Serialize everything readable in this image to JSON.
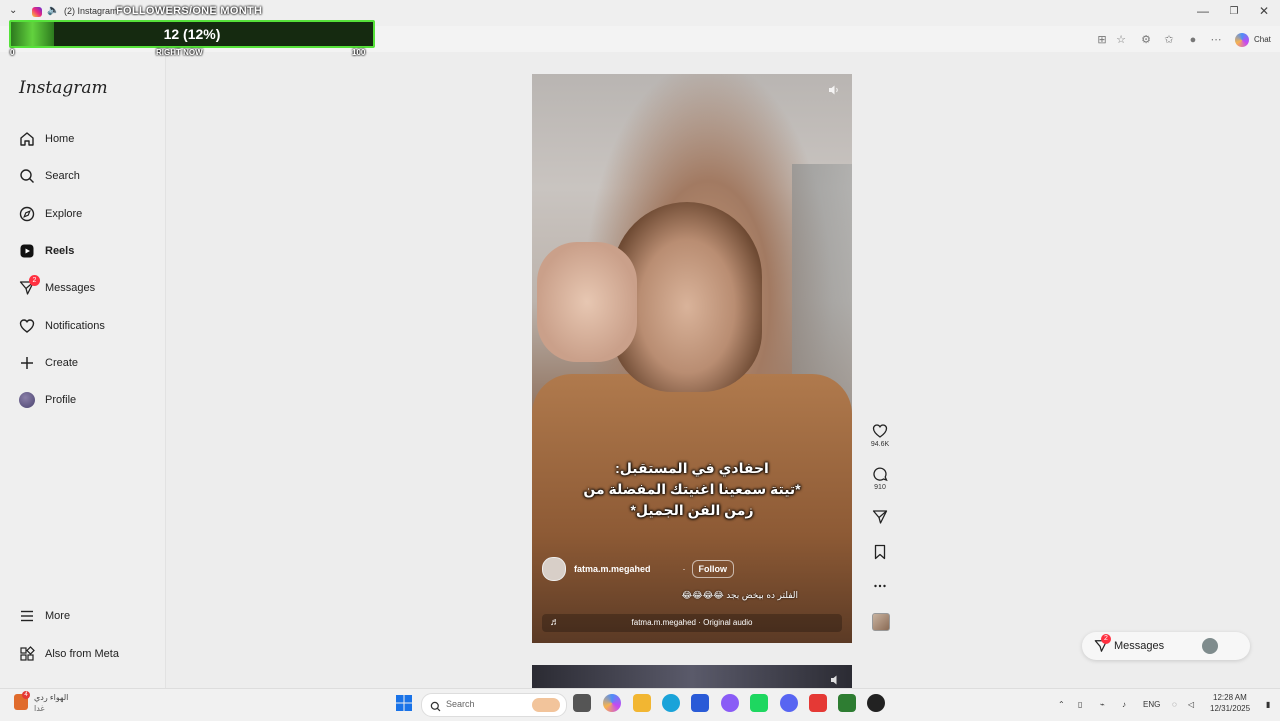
{
  "browser": {
    "tab_title": "(2) Instagram",
    "chat_label": "Chat",
    "window_controls": {
      "minimize": "—",
      "restore": "❐",
      "close": "✕"
    }
  },
  "overlay": {
    "title": "FOLLOWERS/ONE MONTH",
    "progress_text": "12 (12%)",
    "progress_fraction": 0.12,
    "left_label": "0",
    "mid_label": "RIGHT NOW",
    "right_label": "100"
  },
  "sidebar": {
    "logo": "Instagram",
    "items": [
      {
        "name": "home",
        "label": "Home",
        "icon": "home-icon"
      },
      {
        "name": "search",
        "label": "Search",
        "icon": "search-icon"
      },
      {
        "name": "explore",
        "label": "Explore",
        "icon": "compass-icon"
      },
      {
        "name": "reels",
        "label": "Reels",
        "icon": "reels-icon",
        "active": true
      },
      {
        "name": "messages",
        "label": "Messages",
        "icon": "send-icon",
        "badge": "2"
      },
      {
        "name": "notifications",
        "label": "Notifications",
        "icon": "heart-icon"
      },
      {
        "name": "create",
        "label": "Create",
        "icon": "plus-icon"
      },
      {
        "name": "profile",
        "label": "Profile",
        "icon": "avatar"
      }
    ],
    "bottom": [
      {
        "name": "more",
        "label": "More",
        "icon": "menu-icon"
      },
      {
        "name": "also-from-meta",
        "label": "Also from Meta",
        "icon": "grid-icon"
      }
    ]
  },
  "reel": {
    "caption_lines": [
      "احفادي في المستقبل:",
      "*تيتة سمعينا اغنيتك المفضلة من",
      "زمن الفن الجميل*"
    ],
    "username": "fatma.m.megahed",
    "separator": "·",
    "follow_label": "Follow",
    "description": "الفلتر ده بيخض بجد 😂😂😂😂",
    "audio": "fatma.m.megahed · Original audio"
  },
  "actions": {
    "likes": "94.6K",
    "comments": "910"
  },
  "messages_pill": {
    "label": "Messages",
    "badge": "2"
  },
  "taskbar": {
    "weather_line1": "الهواء ردي",
    "weather_line2": "غدا",
    "weather_badge": "4",
    "search_placeholder": "Search",
    "lang": "ENG",
    "time": "12:28 AM",
    "date": "12/31/2025"
  }
}
